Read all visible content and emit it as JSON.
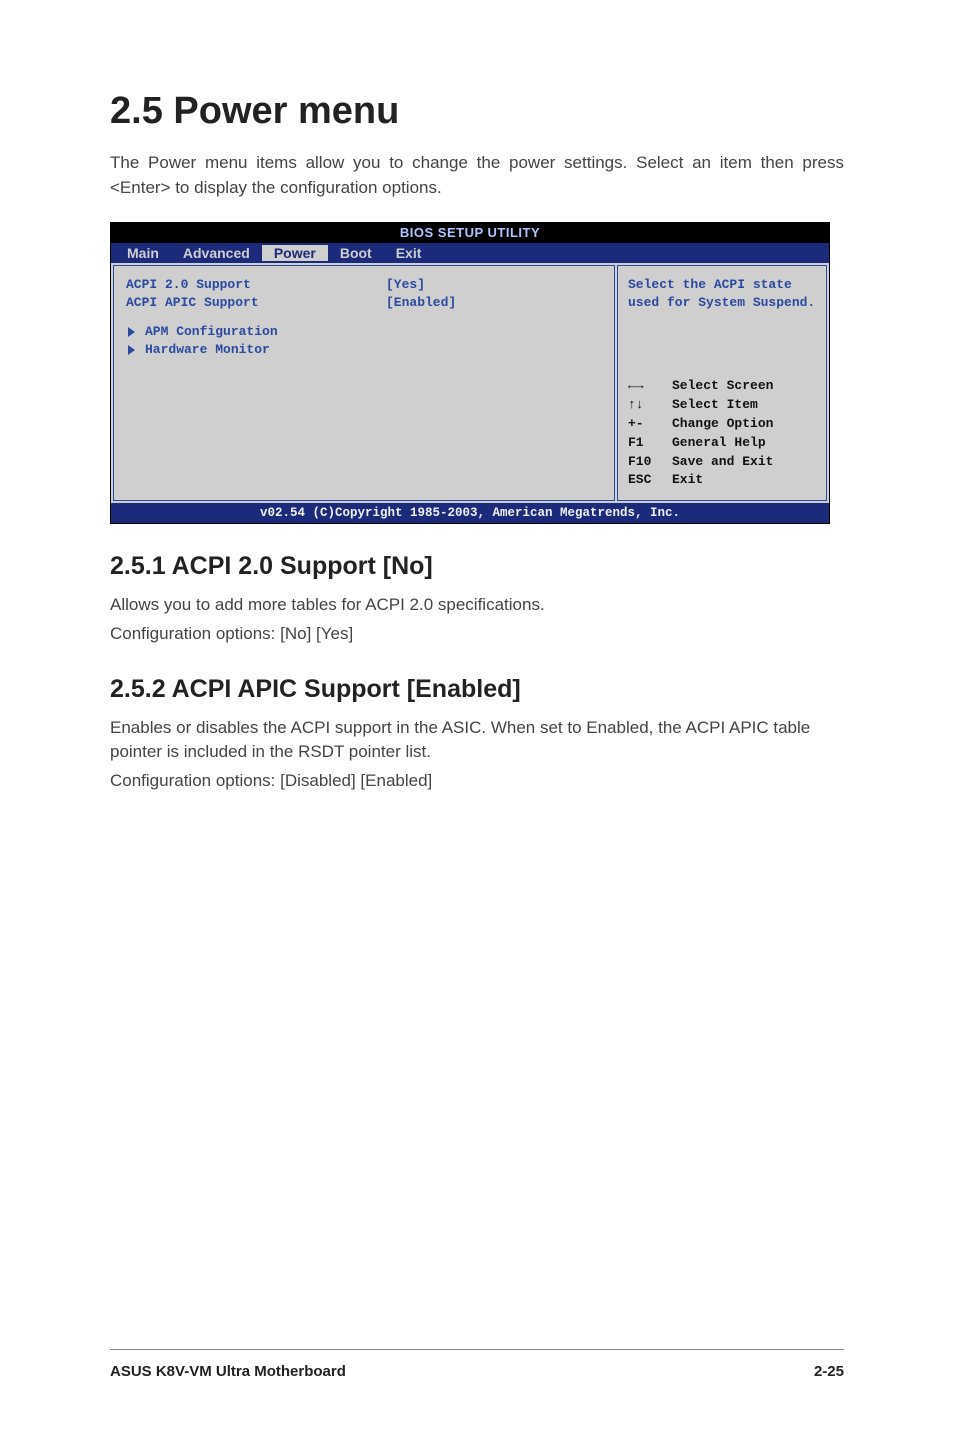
{
  "heading_main": "2.5   Power menu",
  "intro": "The Power menu items allow you to change the power settings. Select an item then press <Enter> to display the configuration options.",
  "bios": {
    "title": "BIOS SETUP UTILITY",
    "tabs": [
      "Main",
      "Advanced",
      "Power",
      "Boot",
      "Exit"
    ],
    "active_tab_index": 2,
    "items": [
      {
        "label": "ACPI 2.0 Support",
        "value": "[Yes]"
      },
      {
        "label": "ACPI APIC Support",
        "value": "[Enabled]"
      }
    ],
    "submenus": [
      "APM Configuration",
      "Hardware Monitor"
    ],
    "help_text": "Select the ACPI state used for System Suspend.",
    "keys": [
      {
        "k": "←→",
        "d": "Select Screen"
      },
      {
        "k": "↑↓",
        "d": "Select Item"
      },
      {
        "k": "+-",
        "d": "Change Option"
      },
      {
        "k": "F1",
        "d": "General Help"
      },
      {
        "k": "F10",
        "d": "Save and Exit"
      },
      {
        "k": "ESC",
        "d": "Exit"
      }
    ],
    "footer": "v02.54 (C)Copyright 1985-2003, American Megatrends, Inc."
  },
  "section1": {
    "heading": "2.5.1   ACPI 2.0 Support [No]",
    "line1": "Allows you to add more tables for ACPI 2.0 specifications.",
    "line2": "Configuration options: [No] [Yes]"
  },
  "section2": {
    "heading": "2.5.2   ACPI APIC Support [Enabled]",
    "line1": "Enables or disables the ACPI support in the ASIC. When set to Enabled, the ACPI APIC table pointer is included in the RSDT pointer list.",
    "line2": "Configuration options: [Disabled] [Enabled]"
  },
  "footer": {
    "left": "ASUS K8V-VM Ultra Motherboard",
    "right": "2-25"
  }
}
